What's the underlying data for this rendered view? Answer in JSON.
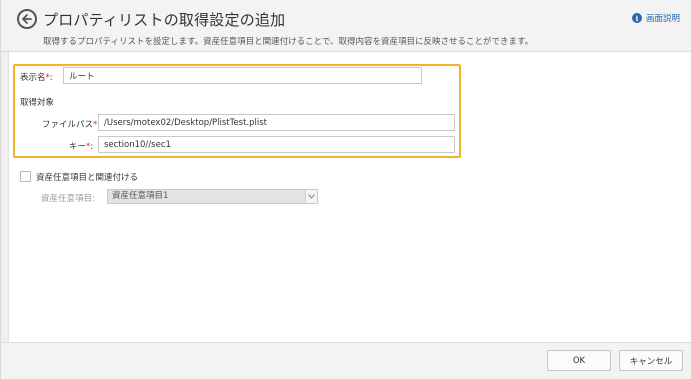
{
  "header": {
    "title": "プロパティリストの取得設定の追加",
    "subtitle": "取得するプロパティリストを設定します。資産任意項目と関連付けることで、取得内容を資産項目に反映させることができます。",
    "help_label": "画面説明"
  },
  "form": {
    "display_name": {
      "label": "表示名",
      "required_mark": "*",
      "colon": ":",
      "value": "ルート"
    },
    "target_section_label": "取得対象",
    "file_path": {
      "label": "ファイルパス",
      "required_mark": "*",
      "colon": ":",
      "value": "/Users/motex02/Desktop/PlistTest.plist"
    },
    "key": {
      "label": "キー",
      "required_mark": "*",
      "colon": ":",
      "value": "section10//sec1"
    },
    "link_checkbox_label": "資産任意項目と関連付ける",
    "asset_item": {
      "label": "資産任意項目:",
      "value": "資産任意項目1"
    }
  },
  "footer": {
    "ok_label": "OK",
    "cancel_label": "キャンセル"
  },
  "colors": {
    "highlight": "#f2b32a",
    "required": "#e0262b",
    "link": "#2b66b5"
  }
}
